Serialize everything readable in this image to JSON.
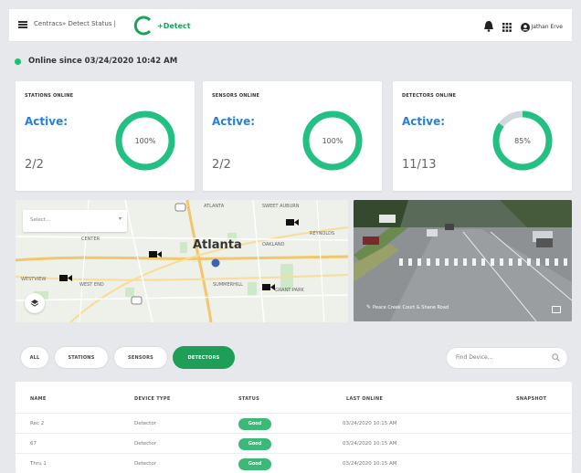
{
  "header": {
    "breadcrumb": "Centracs» Detect Status |",
    "logo_text": "+Detect",
    "user_name": "Jathan Erve",
    "icons": [
      "menu-icon",
      "logo-icon",
      "bell-icon",
      "apps-grid-icon",
      "user-icon"
    ]
  },
  "status": {
    "text": "Online since 03/24/2020 10:42 AM",
    "color": "#1fbf6f"
  },
  "cards": [
    {
      "title": "STATIONS ONLINE",
      "active_label": "Active:",
      "count": "2/2",
      "percent_label": "100%",
      "percent": 1.0
    },
    {
      "title": "SENSORS ONLINE",
      "active_label": "Active:",
      "count": "2/2",
      "percent_label": "100%",
      "percent": 1.0
    },
    {
      "title": "DETECTORS ONLINE",
      "active_label": "Active:",
      "count": "11/13",
      "percent_label": "85%",
      "percent": 0.85
    }
  ],
  "map": {
    "select_placeholder": "Select...",
    "city_label": "Atlanta",
    "labels": [
      "ATLANTA",
      "SWEET AUBURN",
      "REYNOLDS",
      "CENTER",
      "OAKLAND",
      "WESTVIEW",
      "WEST END",
      "SUMMERHILL",
      "GRANT PARK"
    ]
  },
  "camera": {
    "caption": "Peace Creek Court & Shane Road"
  },
  "filters": {
    "all": "ALL",
    "stations": "STATIONS",
    "sensors": "SENSORS",
    "detectors": "DETECTORS",
    "search_placeholder": "Find Device..."
  },
  "table": {
    "columns": [
      "NAME",
      "DEVICE TYPE",
      "STATUS",
      "LAST ONLINE",
      "SNAPSHOT"
    ],
    "rows": [
      {
        "name": "Rec 2",
        "type": "Detector",
        "status": "Good",
        "last": "03/24/2020 10:15 AM"
      },
      {
        "name": "67",
        "type": "Detector",
        "status": "Good",
        "last": "03/24/2020 10:15 AM"
      },
      {
        "name": "Thru 1",
        "type": "Detector",
        "status": "Good",
        "last": "03/24/2020 10:15 AM"
      }
    ]
  },
  "colors": {
    "accent": "#1e9e57",
    "donut": "#22c083",
    "donut_track": "#d3d8df",
    "link_blue": "#2a7fd4"
  }
}
